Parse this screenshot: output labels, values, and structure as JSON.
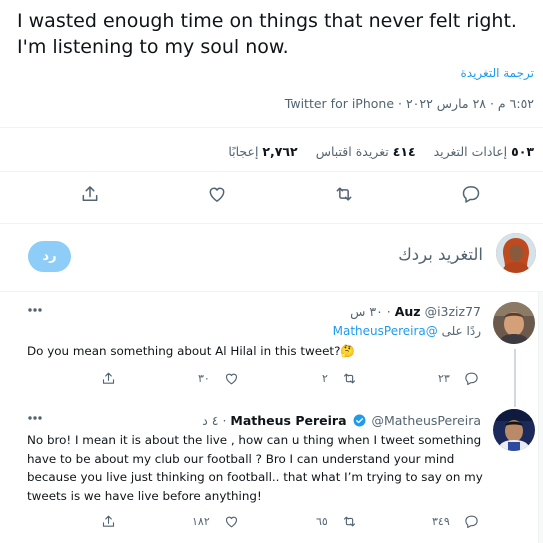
{
  "tweet": {
    "text_line1": "I wasted enough time on things that never felt right.",
    "text_line2": "I'm listening to my soul now.",
    "translate_label": "ترجمة التغريدة",
    "meta": "٦:٥٢ م · ٢٨ مارس ٢٠٢٢ · Twitter for iPhone"
  },
  "stats": {
    "retweets_count": "٥٠٣",
    "retweets_label": "إعادات التغريد",
    "quotes_count": "٤١٤",
    "quotes_label": "تغريدة اقتباس",
    "likes_count": "٢,٧٦٢",
    "likes_label": "إعجابًا"
  },
  "composer": {
    "prompt": "التغريد بردك",
    "reply_button": "رد"
  },
  "replies": [
    {
      "name": "Auz",
      "handle": "@i3ziz77",
      "time": "٣٠ س",
      "replying_prefix": "ردًا على",
      "replying_to": "@MatheusPereira",
      "text_lines": [
        "Do you mean something about Al Hilal in this tweet?🤔"
      ],
      "reply_count": "٢٣",
      "retweet_count": "٢",
      "like_count": "٣٠"
    },
    {
      "name": "Matheus Pereira",
      "handle": "@MatheusPereira",
      "time": "٤ د",
      "text_lines": [
        "No bro! I mean it is about the live , how can u thing when I tweet something",
        "have to be about my club our football ? Bro I can understand your mind",
        "because you live  just thinking  on football.. that what  I’m trying to say on my",
        "tweets is we have live before anything!"
      ],
      "reply_count": "٣٤٩",
      "retweet_count": "٦٥",
      "like_count": "١٨٢"
    }
  ],
  "colors": {
    "accent": "#1d9bf0",
    "reply_button_disabled": "#8ecdf8",
    "secondary_text": "#536471"
  }
}
